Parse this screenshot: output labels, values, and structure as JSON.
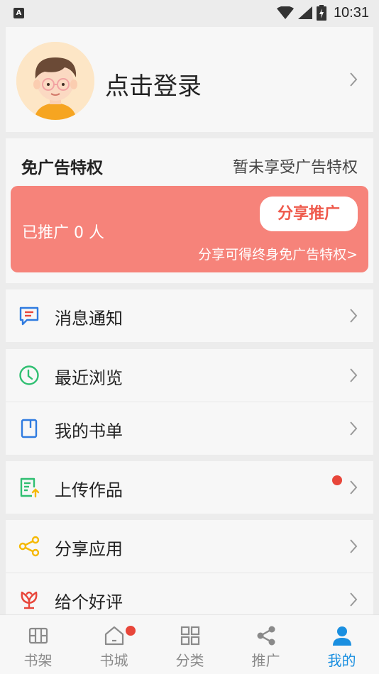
{
  "status_bar": {
    "time": "10:31",
    "indicator": "A"
  },
  "profile": {
    "login_label": "点击登录"
  },
  "ad_privilege": {
    "title": "免广告特权",
    "status": "暂未享受广告特权",
    "promoted_count": "已推广 0 人",
    "share_button": "分享推广",
    "share_hint": "分享可得终身免广告特权>"
  },
  "menu": {
    "messages": "消息通知",
    "recent": "最近浏览",
    "booklist": "我的书单",
    "upload": "上传作品",
    "share_app": "分享应用",
    "rate": "给个好评"
  },
  "tabs": [
    {
      "label": "书架",
      "icon": "bookshelf-icon"
    },
    {
      "label": "书城",
      "icon": "home-icon"
    },
    {
      "label": "分类",
      "icon": "category-icon"
    },
    {
      "label": "推广",
      "icon": "share-icon"
    },
    {
      "label": "我的",
      "icon": "user-icon"
    }
  ],
  "colors": {
    "accent_blue": "#1a8fe0",
    "banner_red": "#f6837a",
    "badge_red": "#e8463a",
    "green": "#2fbf71",
    "yellow": "#f5b800"
  }
}
